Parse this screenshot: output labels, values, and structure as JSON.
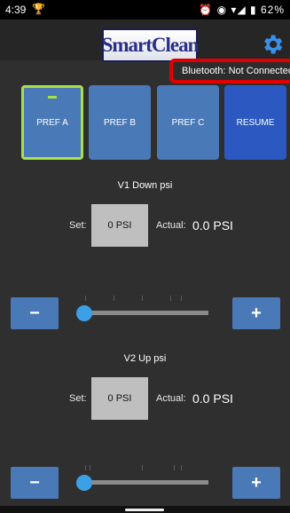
{
  "status_bar": {
    "time": "4:39",
    "icons": "⏰ ◉ ▾◢ ▮",
    "battery": "62%"
  },
  "header": {
    "logo_text": "SmartClean",
    "settings_icon": "gear-icon",
    "bluetooth_status": "Bluetooth: Not Connected"
  },
  "pref_buttons": [
    {
      "label": "PREF A",
      "selected": true
    },
    {
      "label": "PREF B",
      "selected": false
    },
    {
      "label": "PREF C",
      "selected": false
    },
    {
      "label": "RESUME",
      "selected": false
    }
  ],
  "v1": {
    "title": "V1 Down psi",
    "set_label": "Set:",
    "set_value": "0 PSI",
    "actual_label": "Actual:",
    "actual_value": "0.0 PSI",
    "slider_level": 0
  },
  "v2": {
    "title": "V2 Up psi",
    "set_label": "Set:",
    "set_value": "0 PSI",
    "actual_label": "Actual:",
    "actual_value": "0.0 PSI",
    "slider_level": 0
  },
  "controls": {
    "minus_label": "−",
    "plus_label": "+"
  },
  "colors": {
    "background": "#2f2f2f",
    "button": "#4a79b7",
    "resume": "#2b59c1",
    "selected_border": "#a8e04a",
    "bt_border": "#e10000",
    "slider_thumb": "#3ca0e6"
  }
}
